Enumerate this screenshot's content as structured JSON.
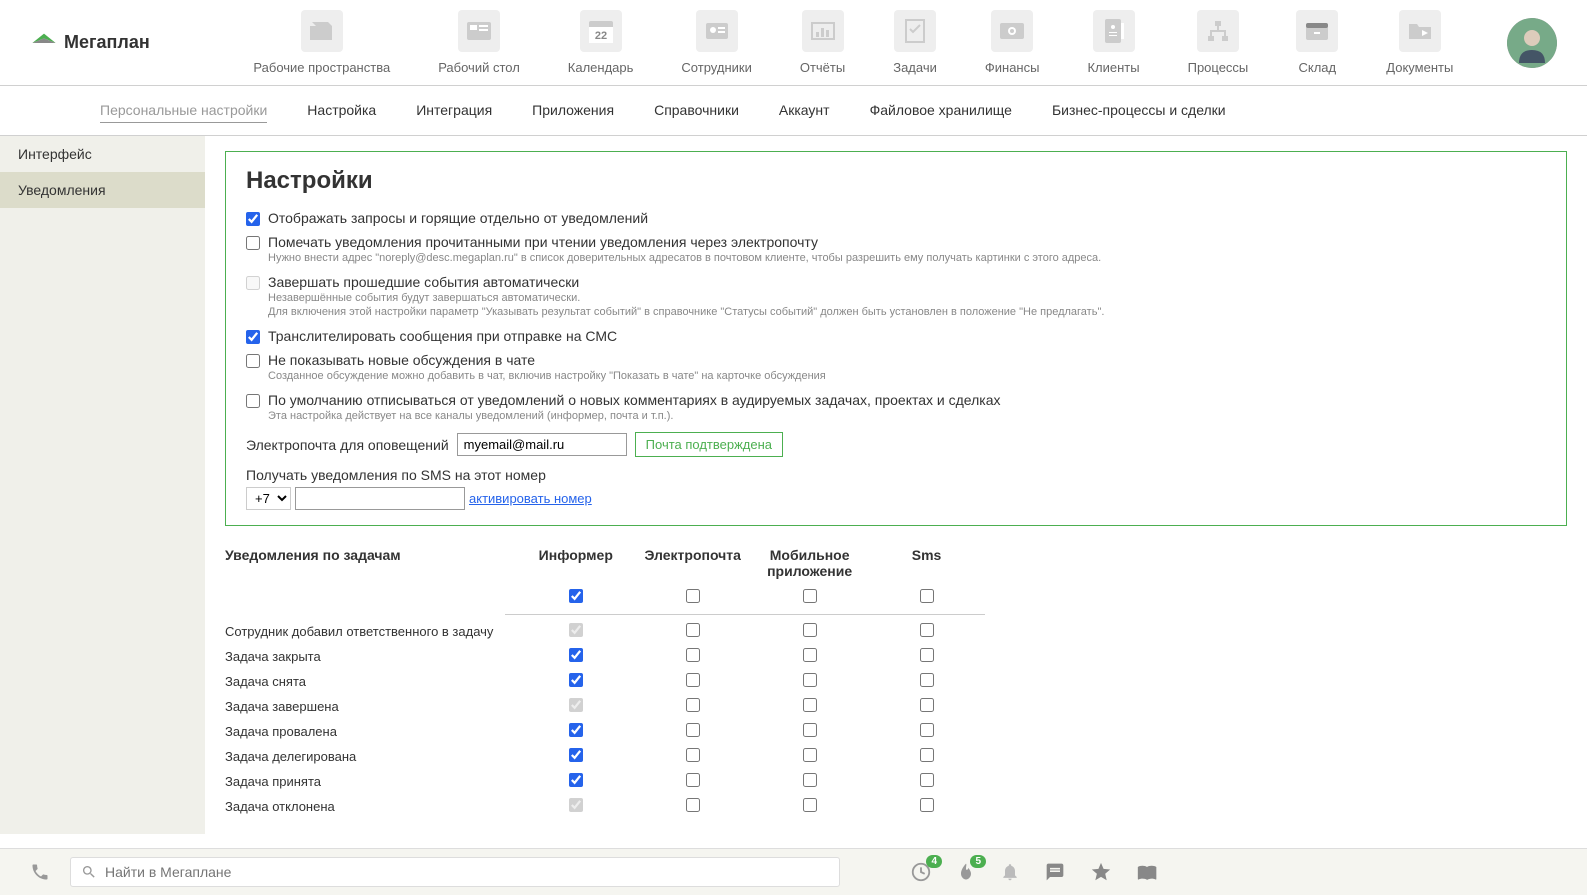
{
  "logo": "Мегаплан",
  "topNav": [
    {
      "label": "Рабочие пространства"
    },
    {
      "label": "Рабочий стол"
    },
    {
      "label": "Календарь",
      "badge": "22"
    },
    {
      "label": "Сотрудники"
    },
    {
      "label": "Отчёты"
    },
    {
      "label": "Задачи"
    },
    {
      "label": "Финансы"
    },
    {
      "label": "Клиенты"
    },
    {
      "label": "Процессы"
    },
    {
      "label": "Склад"
    },
    {
      "label": "Документы"
    }
  ],
  "subNav": [
    {
      "label": "Персональные настройки",
      "active": true
    },
    {
      "label": "Настройка"
    },
    {
      "label": "Интеграция"
    },
    {
      "label": "Приложения"
    },
    {
      "label": "Справочники"
    },
    {
      "label": "Аккаунт"
    },
    {
      "label": "Файловое хранилище"
    },
    {
      "label": "Бизнес-процессы и сделки"
    }
  ],
  "sidebar": [
    {
      "label": "Интерфейс"
    },
    {
      "label": "Уведомления",
      "active": true
    }
  ],
  "pageTitle": "Настройки",
  "settings": {
    "opt1": {
      "label": "Отображать запросы и горящие отдельно от уведомлений",
      "checked": true
    },
    "opt2": {
      "label": "Помечать уведомления прочитанными при чтении уведомления через электропочту",
      "checked": false,
      "hint": "Нужно внести адрес \"noreply@desc.megaplan.ru\" в список доверительных адресатов в почтовом клиенте, чтобы разрешить ему получать картинки с этого адреса."
    },
    "opt3": {
      "label": "Завершать прошедшие события автоматически",
      "checked": false,
      "disabled": true,
      "hint1": "Незавершённые события будут завершаться автоматически.",
      "hint2": "Для включения этой настройки параметр \"Указывать результат событий\" в справочнике \"Статусы событий\" должен быть установлен в положение \"Не предлагать\"."
    },
    "opt4": {
      "label": "Транслителировать сообщения при отправке на СМС",
      "checked": true
    },
    "opt5": {
      "label": "Не показывать новые обсуждения в чате",
      "checked": false,
      "hint": "Созданное обсуждение можно добавить в чат, включив настройку \"Показать в чате\" на карточке обсуждения"
    },
    "opt6": {
      "label": "По умолчанию отписываться от уведомлений о новых комментариях в аудируемых задачах, проектах и сделках",
      "checked": false,
      "hint": "Эта настройка действует на все каналы уведомлений (информер, почта и т.п.)."
    },
    "emailLabel": "Электропочта для оповещений",
    "emailValue": "myemail@mail.ru",
    "emailConfirmed": "Почта подтверждена",
    "smsLabel": "Получать уведомления по SMS на этот номер",
    "phonePrefix": "+7",
    "activateLink": "активировать номер"
  },
  "table": {
    "title": "Уведомления по задачам",
    "cols": [
      "Информер",
      "Электропочта",
      "Мобильное приложение",
      "Sms"
    ],
    "rows": [
      {
        "label": "",
        "checks": [
          true,
          false,
          false,
          false
        ],
        "disabled": [
          false,
          false,
          false,
          false
        ]
      },
      {
        "label": "Сотрудник добавил ответственного в задачу",
        "checks": [
          true,
          false,
          false,
          false
        ],
        "disabled": [
          true,
          false,
          false,
          false
        ]
      },
      {
        "label": "Задача закрыта",
        "checks": [
          true,
          false,
          false,
          false
        ],
        "disabled": [
          false,
          false,
          false,
          false
        ]
      },
      {
        "label": "Задача снята",
        "checks": [
          true,
          false,
          false,
          false
        ],
        "disabled": [
          false,
          false,
          false,
          false
        ]
      },
      {
        "label": "Задача завершена",
        "checks": [
          true,
          false,
          false,
          false
        ],
        "disabled": [
          true,
          false,
          false,
          false
        ]
      },
      {
        "label": "Задача провалена",
        "checks": [
          true,
          false,
          false,
          false
        ],
        "disabled": [
          false,
          false,
          false,
          false
        ]
      },
      {
        "label": "Задача делегирована",
        "checks": [
          true,
          false,
          false,
          false
        ],
        "disabled": [
          false,
          false,
          false,
          false
        ]
      },
      {
        "label": "Задача принята",
        "checks": [
          true,
          false,
          false,
          false
        ],
        "disabled": [
          false,
          false,
          false,
          false
        ]
      },
      {
        "label": "Задача отклонена",
        "checks": [
          true,
          false,
          false,
          false
        ],
        "disabled": [
          true,
          false,
          false,
          false
        ]
      }
    ]
  },
  "footer": {
    "searchPlaceholder": "Найти в Мегаплане",
    "badge1": "4",
    "badge2": "5"
  }
}
